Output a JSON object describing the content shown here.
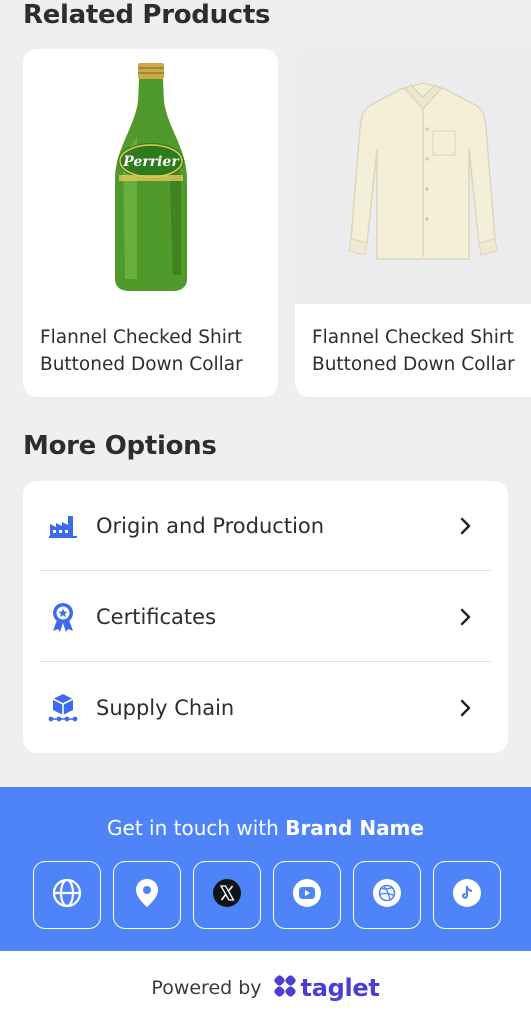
{
  "related": {
    "title": "Related Products",
    "products": [
      {
        "name": "Flannel Checked Shirt\nButtoned Down Collar",
        "image": "green-glass-bottle",
        "bottle_label": "Perrier"
      },
      {
        "name": "Flannel Checked Shirt\nButtoned Down Collar",
        "image": "cream-shirt"
      }
    ]
  },
  "options": {
    "title": "More Options",
    "items": [
      {
        "label": "Origin and Production",
        "icon": "factory-icon"
      },
      {
        "label": "Certificates",
        "icon": "award-icon"
      },
      {
        "label": "Supply Chain",
        "icon": "supply-chain-icon"
      }
    ]
  },
  "footer": {
    "contact_prefix": "Get in touch with",
    "brand_name": "Brand Name",
    "socials": [
      "globe-icon",
      "location-icon",
      "x-icon",
      "youtube-icon",
      "dribbble-icon",
      "tiktok-icon"
    ],
    "powered_by": "Powered by",
    "powered_brand": "taglet"
  },
  "colors": {
    "accent": "#4e84f7",
    "icon_blue": "#3d6bf0",
    "brand_purple": "#4a3ed4",
    "background": "#efefef"
  }
}
